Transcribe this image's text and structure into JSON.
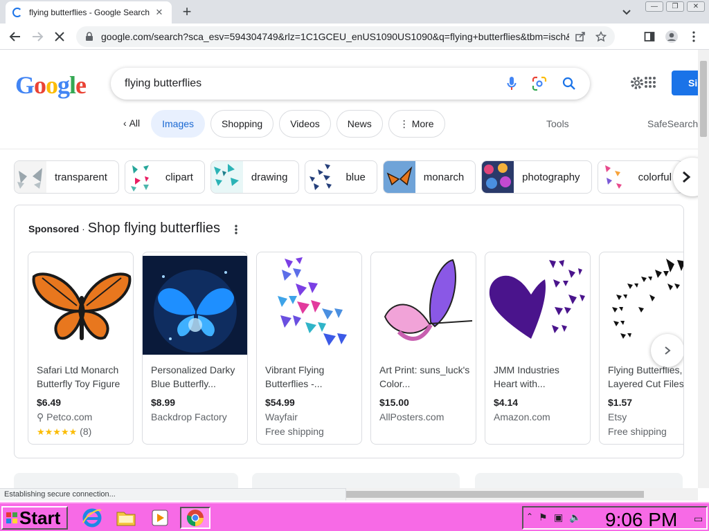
{
  "browser": {
    "tab_title": "flying butterflies - Google Search",
    "url": "google.com/search?sca_esv=594304749&rlz=1C1GCEU_enUS1090US1090&q=flying+butterflies&tbm=isch&sou...",
    "status_text": "Establishing secure connection..."
  },
  "google": {
    "logo_letters": [
      "G",
      "o",
      "o",
      "g",
      "l",
      "e"
    ],
    "query": "flying butterflies",
    "signin_label": "Si",
    "filters": [
      {
        "label": "All",
        "state": "back"
      },
      {
        "label": "Images",
        "state": "active"
      },
      {
        "label": "Shopping",
        "state": "normal"
      },
      {
        "label": "Videos",
        "state": "normal"
      },
      {
        "label": "News",
        "state": "normal"
      },
      {
        "label": "More",
        "state": "more"
      }
    ],
    "tools_label": "Tools",
    "safesearch_label": "SafeSearch",
    "related": [
      {
        "label": "transparent",
        "thumb": "light"
      },
      {
        "label": "clipart",
        "thumb": "teal"
      },
      {
        "label": "drawing",
        "thumb": "teal"
      },
      {
        "label": "blue",
        "thumb": "navy"
      },
      {
        "label": "monarch",
        "thumb": "monarch"
      },
      {
        "label": "photography",
        "thumb": "colorful"
      },
      {
        "label": "colorful",
        "thumb": "pink"
      }
    ],
    "sponsored": {
      "label": "Sponsored",
      "separator": "·",
      "title": "Shop flying butterflies",
      "products": [
        {
          "name": "Safari Ltd Monarch Butterfly Toy Figure",
          "price": "$6.49",
          "store": "Petco.com",
          "has_pin": true,
          "rating_stars": "★★★★★",
          "rating_count": "(8)",
          "extra": "",
          "image": "monarch"
        },
        {
          "name": "Personalized Darky Blue Butterfly...",
          "price": "$8.99",
          "store": "Backdrop Factory",
          "has_pin": false,
          "rating_stars": "",
          "rating_count": "",
          "extra": "",
          "image": "dark-blue"
        },
        {
          "name": "Vibrant Flying Butterflies -...",
          "price": "$54.99",
          "store": "Wayfair",
          "has_pin": false,
          "rating_stars": "",
          "rating_count": "",
          "extra": "Free shipping",
          "image": "vibrant"
        },
        {
          "name": "Art Print: suns_luck's Color...",
          "price": "$15.00",
          "store": "AllPosters.com",
          "has_pin": false,
          "rating_stars": "",
          "rating_count": "",
          "extra": "",
          "image": "pink-purple"
        },
        {
          "name": "JMM Industries Heart with...",
          "price": "$4.14",
          "store": "Amazon.com",
          "has_pin": false,
          "rating_stars": "",
          "rating_count": "",
          "extra": "",
          "image": "purple-heart"
        },
        {
          "name": "Flying Butterflies, Layered Cut Files",
          "price": "$1.57",
          "store": "Etsy",
          "has_pin": false,
          "rating_stars": "",
          "rating_count": "",
          "extra": "Free shipping",
          "image": "black-silhouettes"
        }
      ]
    }
  },
  "taskbar": {
    "start_label": "Start",
    "clock": "9:06 PM"
  },
  "colors": {
    "accent": "#1a73e8",
    "taskbar": "#f76ae6",
    "star": "#fbbc04"
  }
}
